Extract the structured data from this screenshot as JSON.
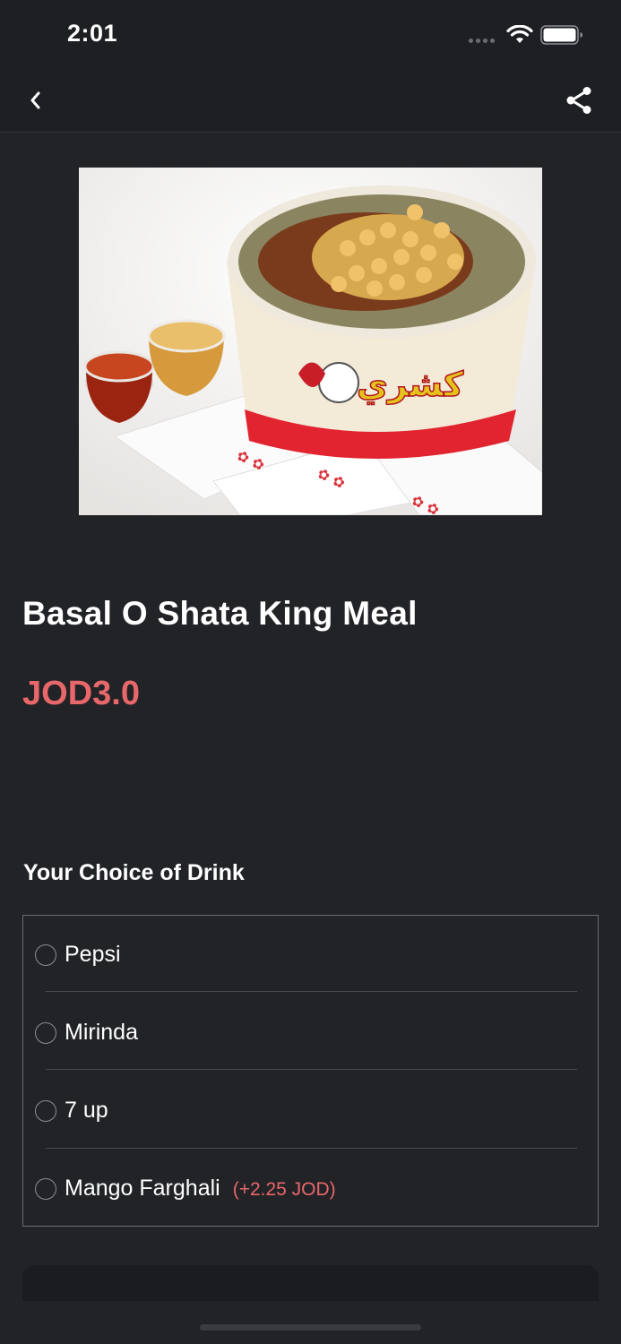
{
  "status_bar": {
    "time": "2:01"
  },
  "nav": {
    "back_icon": "chevron-left-icon",
    "share_icon": "share-icon"
  },
  "product": {
    "title": "Basal O Shata King Meal",
    "price": "JOD3.0",
    "image_alt": "Koshary bowl with sauces"
  },
  "drink_section": {
    "title": "Your Choice of Drink",
    "options": [
      {
        "label": "Pepsi",
        "extra": ""
      },
      {
        "label": "Mirinda",
        "extra": ""
      },
      {
        "label": "7 up",
        "extra": ""
      },
      {
        "label": "Mango Farghali",
        "extra": "(+2.25 JOD)"
      }
    ]
  },
  "colors": {
    "background": "#222327",
    "bar": "#1e1f23",
    "accent": "#e8676a",
    "text": "#ffffff"
  }
}
